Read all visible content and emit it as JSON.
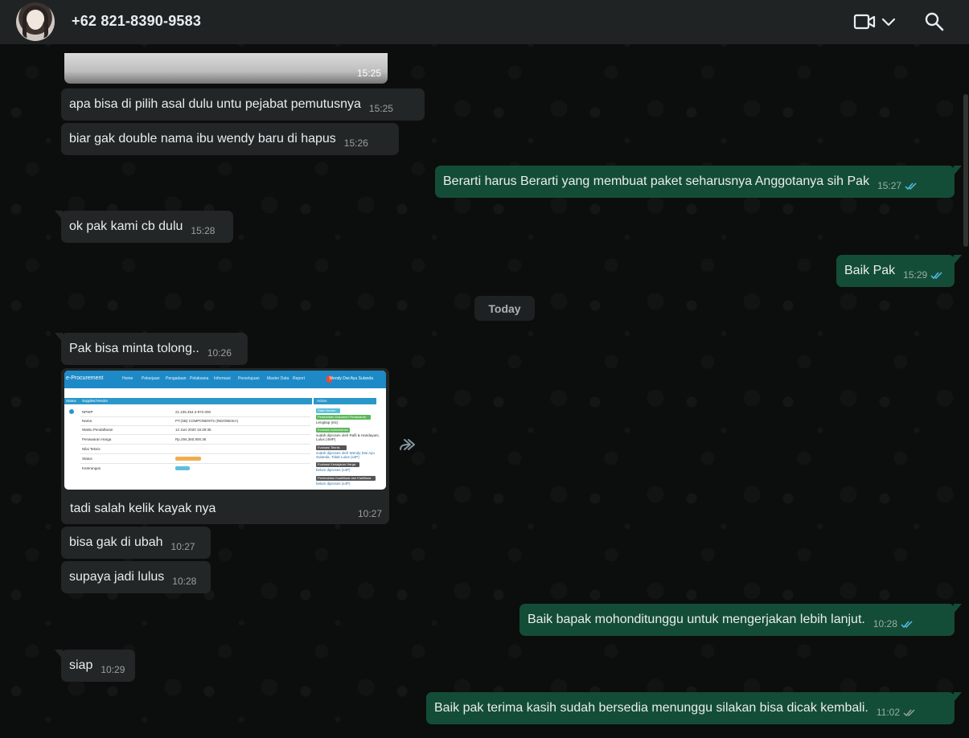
{
  "header": {
    "contact_name": "+62 821-8390-9583",
    "icons": [
      "avatar",
      "video-call-icon",
      "chevron-down-icon",
      "search-icon"
    ]
  },
  "colors": {
    "header_bg": "#202324",
    "incoming_bubble": "#232626",
    "outgoing_bubble": "#144d37",
    "read_ticks": "#53bdeb",
    "chat_bg": "#0c0d0d"
  },
  "messages": [
    {
      "id": "m1",
      "dir": "in",
      "type": "image",
      "time": "15:25"
    },
    {
      "id": "m2",
      "dir": "in",
      "text": "apa bisa di pilih asal dulu untu pejabat pemutusnya",
      "time": "15:25"
    },
    {
      "id": "m3",
      "dir": "in",
      "text": "biar gak double nama ibu wendy baru di hapus",
      "time": "15:26"
    },
    {
      "id": "m4",
      "dir": "out",
      "text": "Berarti harus Berarti yang membuat paket seharusnya Anggotanya sih Pak",
      "time": "15:27",
      "status": "read"
    },
    {
      "id": "m5",
      "dir": "in",
      "text": "ok pak kami cb dulu",
      "time": "15:28"
    },
    {
      "id": "m6",
      "dir": "out",
      "text": "Baik Pak",
      "time": "15:29",
      "status": "read"
    },
    {
      "id": "m7",
      "dir": "in",
      "text": "Pak bisa minta tolong..",
      "time": "10:26"
    },
    {
      "id": "m8",
      "dir": "in",
      "type": "image",
      "caption": "tadi salah kelik kayak nya",
      "time": "10:27"
    },
    {
      "id": "m9",
      "dir": "in",
      "text": "bisa gak di ubah",
      "time": "10:27"
    },
    {
      "id": "m10",
      "dir": "in",
      "text": "supaya jadi lulus",
      "time": "10:28"
    },
    {
      "id": "m11",
      "dir": "out",
      "text": "Baik bapak mohonditunggu untuk mengerjakan lebih lanjut.",
      "time": "10:28",
      "status": "read"
    },
    {
      "id": "m12",
      "dir": "in",
      "text": "siap",
      "time": "10:29"
    },
    {
      "id": "m13",
      "dir": "out",
      "text": "Baik pak terima kasih sudah bersedia menunggu silakan bisa dicak kembali.",
      "time": "11:02",
      "status": "read"
    }
  ],
  "date_divider": "Today",
  "screenshot": {
    "brand": "e-Procurement",
    "nav": [
      "Home",
      "Pekerjaan",
      "Pengadaan",
      "Pelaksana",
      "Informasi",
      "Persetujuan",
      "Master Data",
      "Report"
    ],
    "user": "Wendy Dwi Ayu Sulanda",
    "left_header": "Supplier/Vendor",
    "left_header_short": "Status",
    "right_header": "Action",
    "rows": [
      {
        "label": "NPWP",
        "value": "21.105.454.2-972.000"
      },
      {
        "label": "Nama",
        "value": "PT.(SB) COMPONENTS (INDONESIA)"
      },
      {
        "label": "Waktu Pendaftaran",
        "value": "12 Juni 2020 16:29:35"
      },
      {
        "label": "Penawaran Harga",
        "value": "Rp.294,360,900.36"
      },
      {
        "label": "Nilai Teknis",
        "value": ""
      },
      {
        "label": "Status",
        "value": ""
      },
      {
        "label": "Keterangan",
        "value": ""
      }
    ],
    "status_badge": "Tidak Memenuhi",
    "ket_badge": "Detail",
    "actions": [
      "Data Vendor",
      "Pemberitan Dokumen Penawaran",
      "Lengkap (etc)",
      "Evaluasi Administrasi",
      "sudah diproses oleh Rafli & Handayani, Lulus (4MP)",
      "Evaluasi Teknis",
      "sudah diproses oleh Wendy Dwi Ayu Sulanda, Tidak Lulus (x4P)",
      "Evaluasi Kewajaran Harga",
      "belum diproses (x4P)",
      "Pembuktian Kualifikasi dan Klarifikasi",
      "belum diproses (x4P)"
    ]
  }
}
